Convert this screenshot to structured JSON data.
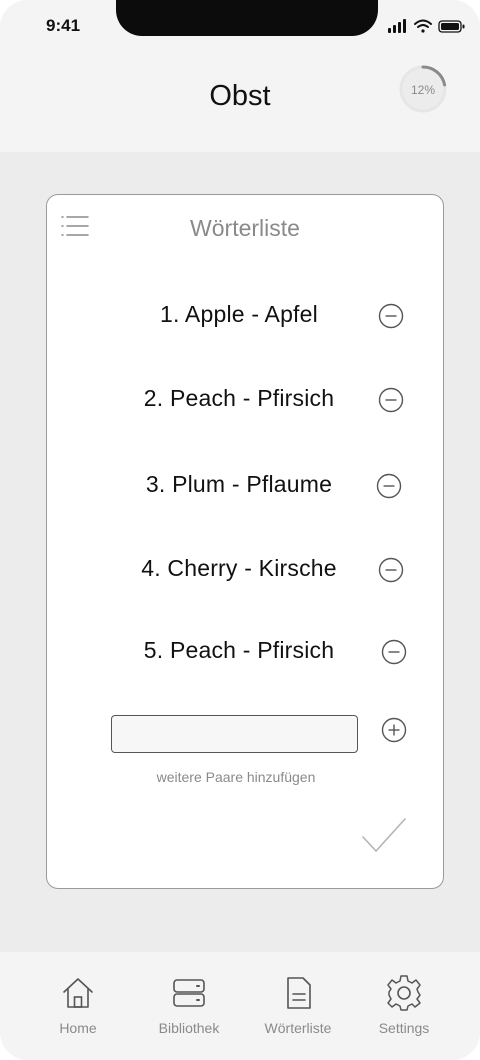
{
  "status_bar": {
    "time": "9:41"
  },
  "header": {
    "title": "Obst",
    "progress_text": "12%",
    "progress_value": 0.12
  },
  "card": {
    "title": "Wörterliste",
    "items": [
      {
        "index": "1.",
        "text": "1.  Apple - Apfel"
      },
      {
        "index": "2.",
        "text": "2.  Peach - Pfirsich"
      },
      {
        "index": "3.",
        "text": "3.  Plum - Pflaume"
      },
      {
        "index": "4.",
        "text": "4.  Cherry - Kirsche"
      },
      {
        "index": "5.",
        "text": "5.   Peach - Pfirsich"
      }
    ],
    "add_input_value": "",
    "add_hint": "weitere Paare hinzufügen"
  },
  "nav": {
    "items": [
      {
        "label": "Home",
        "icon": "home-icon"
      },
      {
        "label": "Bibliothek",
        "icon": "server-icon"
      },
      {
        "label": "Wörterliste",
        "icon": "document-icon"
      },
      {
        "label": "Settings",
        "icon": "gear-icon"
      }
    ]
  },
  "colors": {
    "accent": "#8a8a8a",
    "background": "#ececec",
    "card": "#ffffff"
  }
}
